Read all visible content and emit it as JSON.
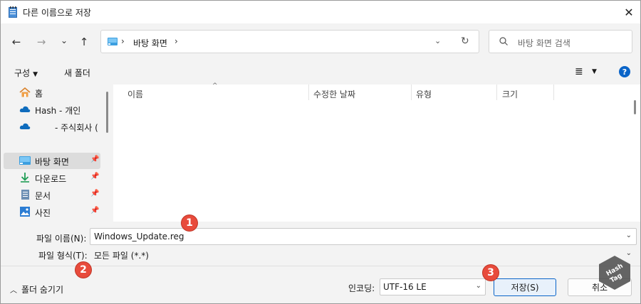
{
  "window": {
    "title": "다른 이름으로 저장",
    "close_label": "✕"
  },
  "nav": {
    "back": "←",
    "forward": "→",
    "recent": "⌄",
    "up": "↑",
    "breadcrumb": [
      "바탕 화면"
    ],
    "search_placeholder": "바탕 화면 검색"
  },
  "toolbar": {
    "organize": "구성",
    "new_folder": "새 폴더",
    "help": "?"
  },
  "sidebar": {
    "items": [
      {
        "label": "홈",
        "icon": "home-icon",
        "pinned": false
      },
      {
        "label": "Hash - 개인",
        "icon": "cloud-icon",
        "pinned": false
      },
      {
        "label": "- 주식회사 (",
        "icon": "cloud-icon",
        "pinned": false
      },
      {
        "label": "바탕 화면",
        "icon": "desktop-icon",
        "pinned": true,
        "selected": true
      },
      {
        "label": "다운로드",
        "icon": "download-icon",
        "pinned": true
      },
      {
        "label": "문서",
        "icon": "document-icon",
        "pinned": true
      },
      {
        "label": "사진",
        "icon": "picture-icon",
        "pinned": true
      }
    ]
  },
  "files": {
    "columns": [
      "이름",
      "수정한 날짜",
      "유형",
      "크기"
    ]
  },
  "form": {
    "filename_label": "파일 이름(N):",
    "filename_value": "Windows_Update.reg",
    "filetype_label": "파일 형식(T):",
    "filetype_value": "모든 파일  (*.*)",
    "encoding_label": "인코딩:",
    "encoding_value": "UTF-16 LE",
    "hide_folders": "폴더 숨기기",
    "save_button": "저장(S)",
    "cancel_button": "취소"
  },
  "callouts": [
    "1",
    "2",
    "3"
  ],
  "watermark": {
    "line1": "Hash",
    "line2": "Tag"
  },
  "colors": {
    "accent": "#0a64c8",
    "callout": "#e84b3c",
    "selected": "#dcdcdc"
  }
}
